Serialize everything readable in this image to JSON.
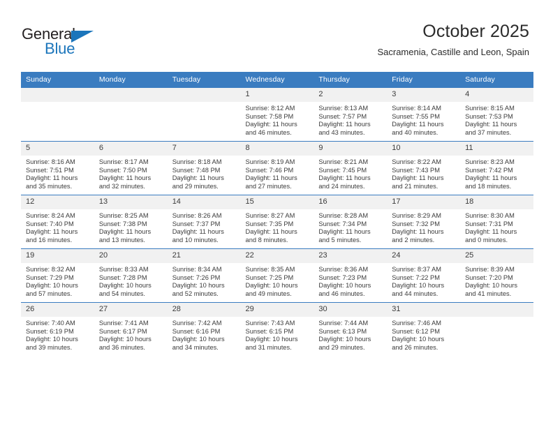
{
  "brand": {
    "name_part1": "General",
    "name_part2": "Blue",
    "triangle_icon": "triangle-icon",
    "accent_color": "#1b75bb"
  },
  "header": {
    "month_title": "October 2025",
    "location": "Sacramenia, Castille and Leon, Spain"
  },
  "calendar": {
    "header_background": "#3a7cc0",
    "daynum_background": "#f1f1f1",
    "weekday_headers": [
      "Sunday",
      "Monday",
      "Tuesday",
      "Wednesday",
      "Thursday",
      "Friday",
      "Saturday"
    ],
    "weeks": [
      [
        {
          "day": "",
          "empty": true
        },
        {
          "day": "",
          "empty": true
        },
        {
          "day": "",
          "empty": true
        },
        {
          "day": "1",
          "sunrise": "Sunrise: 8:12 AM",
          "sunset": "Sunset: 7:58 PM",
          "daylight": "Daylight: 11 hours and 46 minutes."
        },
        {
          "day": "2",
          "sunrise": "Sunrise: 8:13 AM",
          "sunset": "Sunset: 7:57 PM",
          "daylight": "Daylight: 11 hours and 43 minutes."
        },
        {
          "day": "3",
          "sunrise": "Sunrise: 8:14 AM",
          "sunset": "Sunset: 7:55 PM",
          "daylight": "Daylight: 11 hours and 40 minutes."
        },
        {
          "day": "4",
          "sunrise": "Sunrise: 8:15 AM",
          "sunset": "Sunset: 7:53 PM",
          "daylight": "Daylight: 11 hours and 37 minutes."
        }
      ],
      [
        {
          "day": "5",
          "sunrise": "Sunrise: 8:16 AM",
          "sunset": "Sunset: 7:51 PM",
          "daylight": "Daylight: 11 hours and 35 minutes."
        },
        {
          "day": "6",
          "sunrise": "Sunrise: 8:17 AM",
          "sunset": "Sunset: 7:50 PM",
          "daylight": "Daylight: 11 hours and 32 minutes."
        },
        {
          "day": "7",
          "sunrise": "Sunrise: 8:18 AM",
          "sunset": "Sunset: 7:48 PM",
          "daylight": "Daylight: 11 hours and 29 minutes."
        },
        {
          "day": "8",
          "sunrise": "Sunrise: 8:19 AM",
          "sunset": "Sunset: 7:46 PM",
          "daylight": "Daylight: 11 hours and 27 minutes."
        },
        {
          "day": "9",
          "sunrise": "Sunrise: 8:21 AM",
          "sunset": "Sunset: 7:45 PM",
          "daylight": "Daylight: 11 hours and 24 minutes."
        },
        {
          "day": "10",
          "sunrise": "Sunrise: 8:22 AM",
          "sunset": "Sunset: 7:43 PM",
          "daylight": "Daylight: 11 hours and 21 minutes."
        },
        {
          "day": "11",
          "sunrise": "Sunrise: 8:23 AM",
          "sunset": "Sunset: 7:42 PM",
          "daylight": "Daylight: 11 hours and 18 minutes."
        }
      ],
      [
        {
          "day": "12",
          "sunrise": "Sunrise: 8:24 AM",
          "sunset": "Sunset: 7:40 PM",
          "daylight": "Daylight: 11 hours and 16 minutes."
        },
        {
          "day": "13",
          "sunrise": "Sunrise: 8:25 AM",
          "sunset": "Sunset: 7:38 PM",
          "daylight": "Daylight: 11 hours and 13 minutes."
        },
        {
          "day": "14",
          "sunrise": "Sunrise: 8:26 AM",
          "sunset": "Sunset: 7:37 PM",
          "daylight": "Daylight: 11 hours and 10 minutes."
        },
        {
          "day": "15",
          "sunrise": "Sunrise: 8:27 AM",
          "sunset": "Sunset: 7:35 PM",
          "daylight": "Daylight: 11 hours and 8 minutes."
        },
        {
          "day": "16",
          "sunrise": "Sunrise: 8:28 AM",
          "sunset": "Sunset: 7:34 PM",
          "daylight": "Daylight: 11 hours and 5 minutes."
        },
        {
          "day": "17",
          "sunrise": "Sunrise: 8:29 AM",
          "sunset": "Sunset: 7:32 PM",
          "daylight": "Daylight: 11 hours and 2 minutes."
        },
        {
          "day": "18",
          "sunrise": "Sunrise: 8:30 AM",
          "sunset": "Sunset: 7:31 PM",
          "daylight": "Daylight: 11 hours and 0 minutes."
        }
      ],
      [
        {
          "day": "19",
          "sunrise": "Sunrise: 8:32 AM",
          "sunset": "Sunset: 7:29 PM",
          "daylight": "Daylight: 10 hours and 57 minutes."
        },
        {
          "day": "20",
          "sunrise": "Sunrise: 8:33 AM",
          "sunset": "Sunset: 7:28 PM",
          "daylight": "Daylight: 10 hours and 54 minutes."
        },
        {
          "day": "21",
          "sunrise": "Sunrise: 8:34 AM",
          "sunset": "Sunset: 7:26 PM",
          "daylight": "Daylight: 10 hours and 52 minutes."
        },
        {
          "day": "22",
          "sunrise": "Sunrise: 8:35 AM",
          "sunset": "Sunset: 7:25 PM",
          "daylight": "Daylight: 10 hours and 49 minutes."
        },
        {
          "day": "23",
          "sunrise": "Sunrise: 8:36 AM",
          "sunset": "Sunset: 7:23 PM",
          "daylight": "Daylight: 10 hours and 46 minutes."
        },
        {
          "day": "24",
          "sunrise": "Sunrise: 8:37 AM",
          "sunset": "Sunset: 7:22 PM",
          "daylight": "Daylight: 10 hours and 44 minutes."
        },
        {
          "day": "25",
          "sunrise": "Sunrise: 8:39 AM",
          "sunset": "Sunset: 7:20 PM",
          "daylight": "Daylight: 10 hours and 41 minutes."
        }
      ],
      [
        {
          "day": "26",
          "sunrise": "Sunrise: 7:40 AM",
          "sunset": "Sunset: 6:19 PM",
          "daylight": "Daylight: 10 hours and 39 minutes."
        },
        {
          "day": "27",
          "sunrise": "Sunrise: 7:41 AM",
          "sunset": "Sunset: 6:17 PM",
          "daylight": "Daylight: 10 hours and 36 minutes."
        },
        {
          "day": "28",
          "sunrise": "Sunrise: 7:42 AM",
          "sunset": "Sunset: 6:16 PM",
          "daylight": "Daylight: 10 hours and 34 minutes."
        },
        {
          "day": "29",
          "sunrise": "Sunrise: 7:43 AM",
          "sunset": "Sunset: 6:15 PM",
          "daylight": "Daylight: 10 hours and 31 minutes."
        },
        {
          "day": "30",
          "sunrise": "Sunrise: 7:44 AM",
          "sunset": "Sunset: 6:13 PM",
          "daylight": "Daylight: 10 hours and 29 minutes."
        },
        {
          "day": "31",
          "sunrise": "Sunrise: 7:46 AM",
          "sunset": "Sunset: 6:12 PM",
          "daylight": "Daylight: 10 hours and 26 minutes."
        },
        {
          "day": "",
          "empty": true
        }
      ]
    ]
  }
}
